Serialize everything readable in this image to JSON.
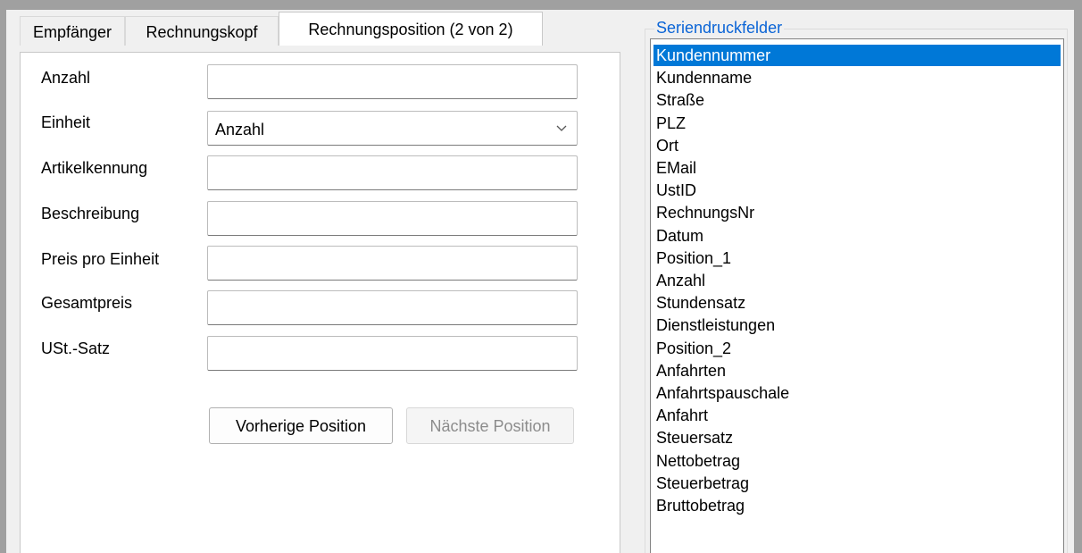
{
  "tabs": [
    {
      "label": "Empfänger"
    },
    {
      "label": "Rechnungskopf"
    },
    {
      "label": "Rechnungsposition (2 von 2)"
    }
  ],
  "form": {
    "anzahl_label": "Anzahl",
    "anzahl_value": "",
    "einheit_label": "Einheit",
    "einheit_value": "Anzahl",
    "artikelkennung_label": "Artikelkennung",
    "artikelkennung_value": "",
    "beschreibung_label": "Beschreibung",
    "beschreibung_value": "",
    "preis_label": "Preis pro Einheit",
    "preis_value": "",
    "gesamtpreis_label": "Gesamtpreis",
    "gesamtpreis_value": "",
    "ust_label": "USt.-Satz",
    "ust_value": ""
  },
  "buttons": {
    "prev_label": "Vorherige Position",
    "next_label": "Nächste Position"
  },
  "seriendruck": {
    "title": "Seriendruckfelder",
    "selected_index": 0,
    "items": [
      "Kundennummer",
      "Kundenname",
      "Straße",
      "PLZ",
      "Ort",
      "EMail",
      "UstID",
      "RechnungsNr",
      "Datum",
      "Position_1",
      "Anzahl",
      "Stundensatz",
      "Dienstleistungen",
      "Position_2",
      "Anfahrten",
      "Anfahrtspauschale",
      "Anfahrt",
      "Steuersatz",
      "Nettobetrag",
      "Steuerbetrag",
      "Bruttobetrag"
    ]
  },
  "colors": {
    "selection": "#0078d7",
    "group_title": "#0a64d6",
    "window_bg": "#f0f0f0"
  }
}
